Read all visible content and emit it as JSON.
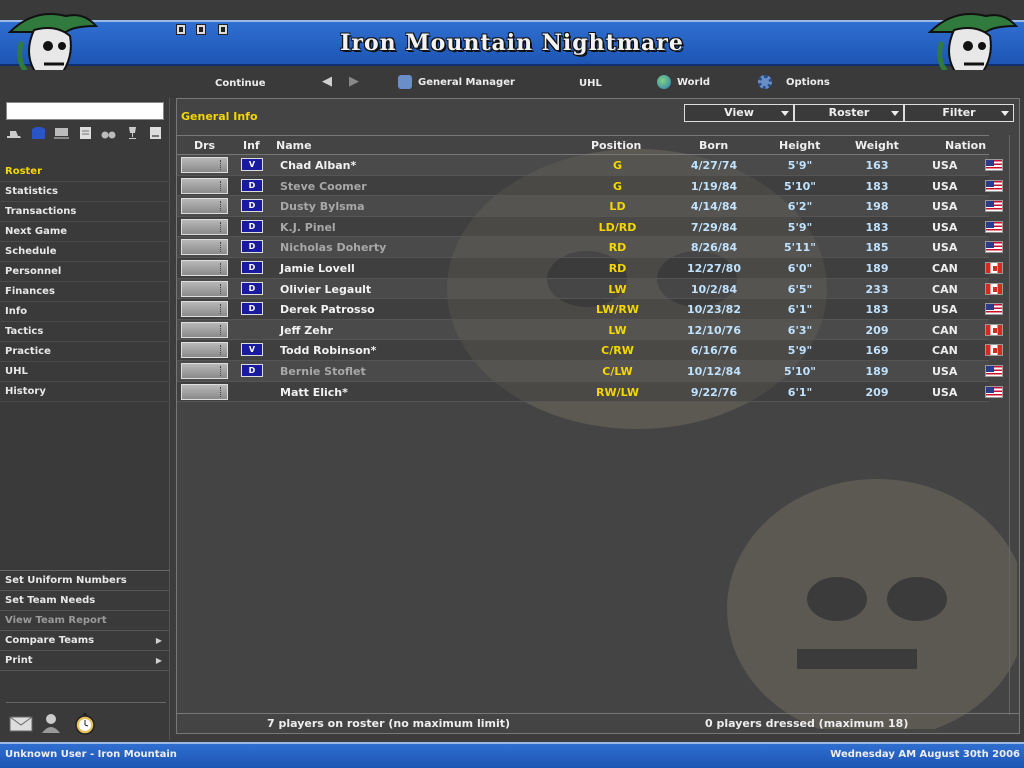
{
  "header": {
    "title": "Iron Mountain Nightmare"
  },
  "nav": {
    "continue": "Continue",
    "general_manager": "General Manager",
    "league": "UHL",
    "world": "World",
    "options": "Options"
  },
  "sidebar": {
    "search_value": "",
    "menu": [
      "Roster",
      "Statistics",
      "Transactions",
      "Next Game",
      "Schedule",
      "Personnel",
      "Finances",
      "Info",
      "Tactics",
      "Practice",
      "UHL",
      "History"
    ],
    "actions": [
      {
        "label": "Set Uniform Numbers",
        "enabled": true,
        "submenu": false
      },
      {
        "label": "Set Team Needs",
        "enabled": true,
        "submenu": false
      },
      {
        "label": "View Team Report",
        "enabled": false,
        "submenu": false
      },
      {
        "label": "Compare Teams",
        "enabled": true,
        "submenu": true
      },
      {
        "label": "Print",
        "enabled": true,
        "submenu": true
      }
    ],
    "bottom_icons": [
      "mail-icon",
      "manager-icon",
      "stopwatch-icon"
    ]
  },
  "main": {
    "title": "General Info",
    "dropdowns": {
      "view": "View",
      "roster": "Roster",
      "filter": "Filter"
    },
    "columns": {
      "drs": "Drs",
      "inf": "Inf",
      "name": "Name",
      "position": "Position",
      "born": "Born",
      "height": "Height",
      "weight": "Weight",
      "nation": "Nation"
    },
    "rows": [
      {
        "inf": "V",
        "name": "Chad Alban*",
        "active": true,
        "position": "G",
        "born": "4/27/74",
        "height": "5'9\"",
        "weight": "163",
        "nation": "USA"
      },
      {
        "inf": "D",
        "name": "Steve Coomer",
        "active": false,
        "position": "G",
        "born": "1/19/84",
        "height": "5'10\"",
        "weight": "183",
        "nation": "USA"
      },
      {
        "inf": "D",
        "name": "Dusty Bylsma",
        "active": false,
        "position": "LD",
        "born": "4/14/84",
        "height": "6'2\"",
        "weight": "198",
        "nation": "USA"
      },
      {
        "inf": "D",
        "name": "K.J. Pinel",
        "active": false,
        "position": "LD/RD",
        "born": "7/29/84",
        "height": "5'9\"",
        "weight": "183",
        "nation": "USA"
      },
      {
        "inf": "D",
        "name": "Nicholas Doherty",
        "active": false,
        "position": "RD",
        "born": "8/26/84",
        "height": "5'11\"",
        "weight": "185",
        "nation": "USA"
      },
      {
        "inf": "D",
        "name": "Jamie Lovell",
        "active": true,
        "position": "RD",
        "born": "12/27/80",
        "height": "6'0\"",
        "weight": "189",
        "nation": "CAN"
      },
      {
        "inf": "D",
        "name": "Olivier Legault",
        "active": true,
        "position": "LW",
        "born": "10/2/84",
        "height": "6'5\"",
        "weight": "233",
        "nation": "CAN"
      },
      {
        "inf": "D",
        "name": "Derek Patrosso",
        "active": true,
        "position": "LW/RW",
        "born": "10/23/82",
        "height": "6'1\"",
        "weight": "183",
        "nation": "USA"
      },
      {
        "inf": "",
        "name": "Jeff Zehr",
        "active": true,
        "position": "LW",
        "born": "12/10/76",
        "height": "6'3\"",
        "weight": "209",
        "nation": "CAN"
      },
      {
        "inf": "V",
        "name": "Todd Robinson*",
        "active": true,
        "position": "C/RW",
        "born": "6/16/76",
        "height": "5'9\"",
        "weight": "169",
        "nation": "CAN"
      },
      {
        "inf": "D",
        "name": "Bernie Stoflet",
        "active": false,
        "position": "C/LW",
        "born": "10/12/84",
        "height": "5'10\"",
        "weight": "189",
        "nation": "USA"
      },
      {
        "inf": "",
        "name": "Matt Elich*",
        "active": true,
        "position": "RW/LW",
        "born": "9/22/76",
        "height": "6'1\"",
        "weight": "209",
        "nation": "USA"
      }
    ],
    "roster_summary": "7 players on roster (no maximum limit)",
    "dressed_summary": "0 players dressed (maximum 18)"
  },
  "status": {
    "user": "Unknown User - Iron Mountain",
    "date": "Wednesday AM August 30th 2006"
  },
  "colors": {
    "header_blue": "#2f6fd0",
    "accent_yellow": "#f6d600",
    "value_blue": "#bfe2ff"
  }
}
